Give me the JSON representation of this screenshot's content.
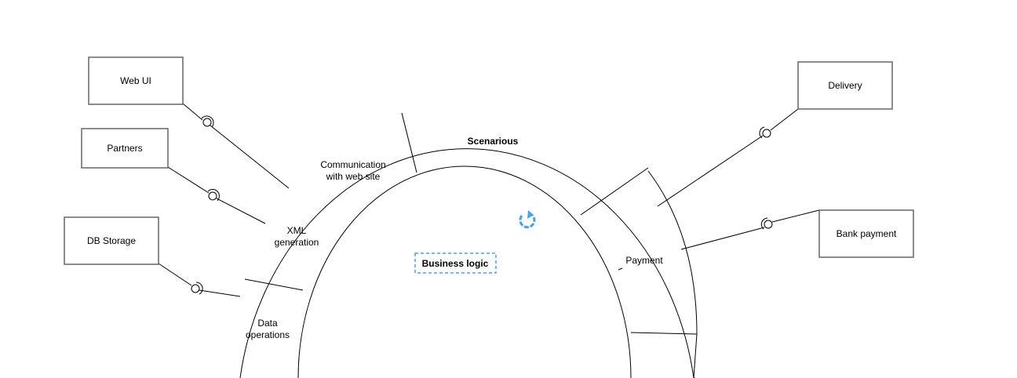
{
  "boxes": {
    "web_ui": "Web UI",
    "partners": "Partners",
    "db_storage": "DB Storage",
    "delivery": "Delivery",
    "bank_payment": "Bank payment"
  },
  "segments": {
    "scenarious": "Scenarious",
    "communication_line1": "Communication",
    "communication_line2": "with web site",
    "xml_line1": "XML",
    "xml_line2": "generation",
    "data_line1": "Data",
    "data_line2": "operations",
    "payment": "Payment"
  },
  "center": {
    "label": "Business logic",
    "icon": "refresh-icon",
    "icon_color": "#4aa3df"
  }
}
